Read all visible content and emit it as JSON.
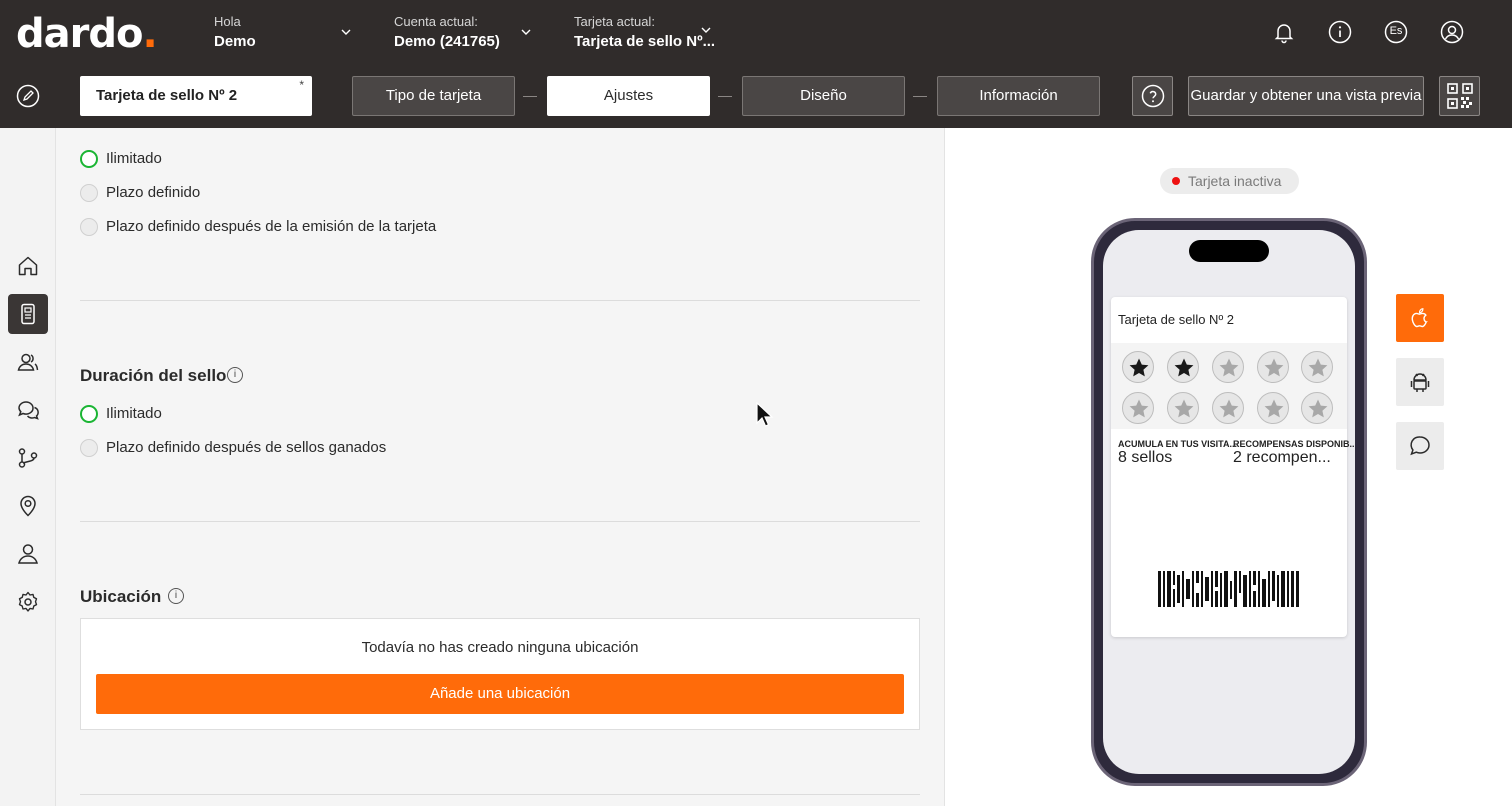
{
  "header": {
    "logo_text": "dardo",
    "logo_dot": ".",
    "greeting_label": "Hola",
    "greeting_name": "Demo",
    "account_label": "Cuenta actual:",
    "account_value": "Demo (241765)",
    "card_label": "Tarjeta actual:",
    "card_value": "Tarjeta de sello Nº...",
    "icons": [
      "bell-icon",
      "info-icon",
      "language-icon",
      "user-icon"
    ],
    "language_code": "Es"
  },
  "toolbar": {
    "card_name": "Tarjeta de sello Nº 2",
    "required_mark": "*",
    "steps": [
      {
        "label": "Tipo de tarjeta",
        "active": false
      },
      {
        "label": "Ajustes",
        "active": true
      },
      {
        "label": "Diseño",
        "active": false
      },
      {
        "label": "Información",
        "active": false
      }
    ],
    "help_icon": "question-icon",
    "save_label": "Guardar y obtener una vista previa",
    "qr_icon": "qr-code-icon"
  },
  "sidenav": {
    "items": [
      "home-icon",
      "cards-icon",
      "customers-icon",
      "messages-icon",
      "automation-icon",
      "locations-icon",
      "managers-icon",
      "settings-icon"
    ],
    "active_index": 1
  },
  "main": {
    "validity_options": [
      {
        "label": "Ilimitado",
        "selected": true
      },
      {
        "label": "Plazo definido",
        "selected": false
      },
      {
        "label": "Plazo definido después de la emisión de la tarjeta",
        "selected": false
      }
    ],
    "stamp_duration": {
      "title": "Duración del sello",
      "info": "i",
      "options": [
        {
          "label": "Ilimitado",
          "selected": true
        },
        {
          "label": "Plazo definido después de sellos ganados",
          "selected": false
        }
      ]
    },
    "location": {
      "title": "Ubicación",
      "info": "i",
      "empty_text": "Todavía no has creado ninguna ubicación",
      "add_label": "Añade una ubicación"
    }
  },
  "preview": {
    "status": "Tarjeta inactiva",
    "status_color": "#e11111",
    "pass": {
      "title": "Tarjeta de sello Nº 2",
      "stamps_total": 10,
      "stamps_filled": 2,
      "field1_label": "ACUMULA EN TUS VISITA...",
      "field1_value": "8 sellos",
      "field2_label": "RECOMPENSAS DISPONIB...",
      "field2_value": "2 recompen..."
    },
    "platforms": [
      {
        "icon": "apple-icon",
        "active": true
      },
      {
        "icon": "android-icon",
        "active": false
      },
      {
        "icon": "chat-icon",
        "active": false
      }
    ]
  },
  "colors": {
    "accent": "#ff6b0a",
    "dark_bar": "#302c2b",
    "selected_radio": "#1bb534"
  }
}
